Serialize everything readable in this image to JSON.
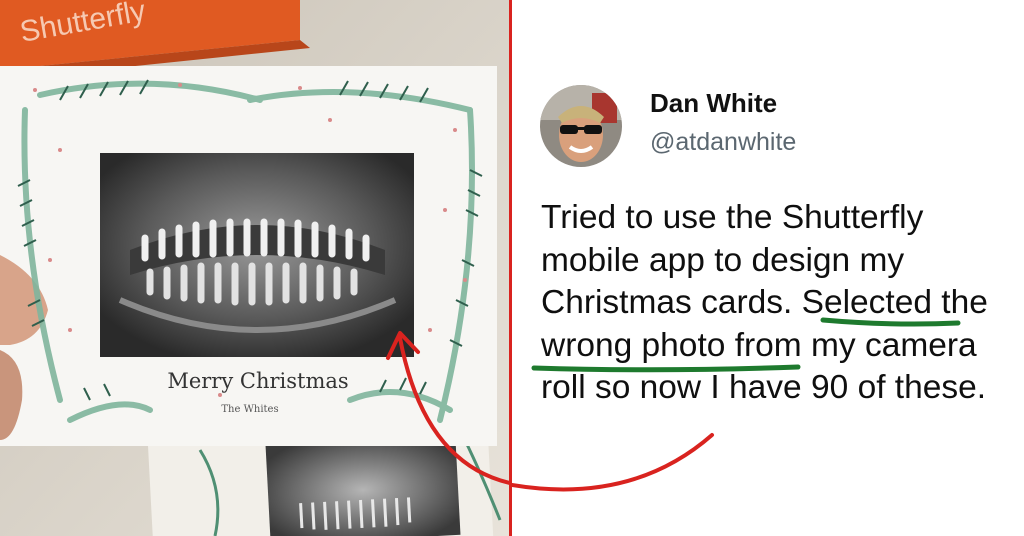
{
  "photo": {
    "box_brand": "Shutterfly",
    "card_greeting": "Merry Christmas",
    "card_signature": "The Whites"
  },
  "tweet": {
    "display_name": "Dan White",
    "handle": "@atdanwhite",
    "text": "Tried to use the Shutterfly mobile app to design my Christmas cards. Selected the wrong photo from my camera roll so now I have 90 of these.",
    "highlighted_phrase": "Selected the wrong photo"
  },
  "colors": {
    "divider": "#d9231f",
    "annotation_arrow": "#d9231f",
    "underline": "#1e7a2e"
  }
}
